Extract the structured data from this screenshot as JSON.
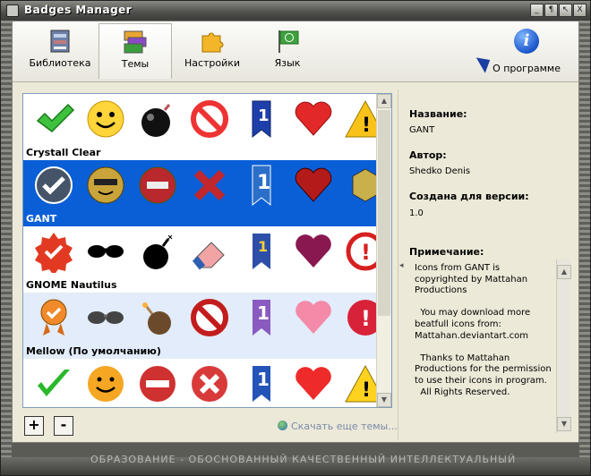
{
  "window": {
    "title": "Badges Manager",
    "controls": [
      "_",
      "¶",
      "↖",
      "X"
    ]
  },
  "toolbar": {
    "items": [
      {
        "label": "Библиотека",
        "icon": "library-icon"
      },
      {
        "label": "Темы",
        "icon": "themes-icon",
        "active": true
      },
      {
        "label": "Настройки",
        "icon": "settings-puzzle-icon"
      },
      {
        "label": "Язык",
        "icon": "language-flag-icon"
      }
    ],
    "about_label": "О программе",
    "about_icon": "info-icon"
  },
  "themes": [
    {
      "name": "Crystall Clear",
      "state": "normal"
    },
    {
      "name": "GANT",
      "state": "selected"
    },
    {
      "name": "GNOME Nautilus",
      "state": "normal"
    },
    {
      "name": "Mellow (По умолчанию)",
      "state": "alt"
    },
    {
      "name": "",
      "state": "normal"
    }
  ],
  "badge_icon_names": [
    "checkmark-icon",
    "smiley-icon",
    "bomb-icon",
    "forbidden-icon",
    "number-one-ribbon-icon",
    "heart-icon",
    "warning-icon"
  ],
  "buttons": {
    "add": "+",
    "remove": "-"
  },
  "download_link": "Скачать еще темы...",
  "details": {
    "name_label": "Название:",
    "name_value": "GANT",
    "author_label": "Автор:",
    "author_value": "Shedko Denis",
    "version_label": "Создана для версии:",
    "version_value": "1.0",
    "note_label": "Примечание:",
    "note_value": "Icons from GANT is copyrighted by Mattahan Productions\n\n  You may download more beatfull icons from: Mattahan.deviantart.com\n\n  Thanks to Mattahan Productions for the permission to use their icons in program.\n  All Rights Reserved."
  },
  "status_ticker": "ОБРАЗОВАНИЕ - ОБОСНОВАННЫЙ КАЧЕСТВЕННЫЙ ИНТЕЛЛЕКТУАЛЬНЫЙ"
}
